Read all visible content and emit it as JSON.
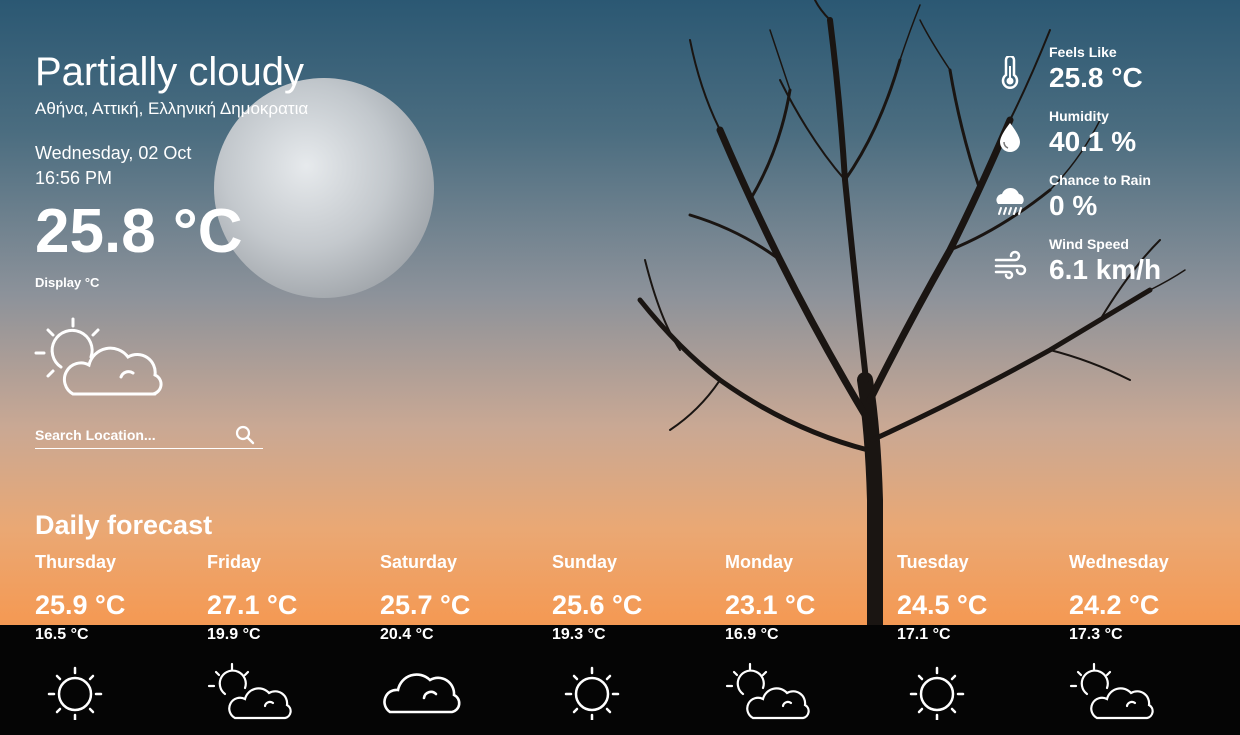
{
  "current": {
    "condition": "Partially cloudy",
    "location": "Αθήνα, Αττική, Ελληνική Δημοκρατια",
    "date": "Wednesday, 02 Oct",
    "time": "16:56 PM",
    "temperature": "25.8 °C",
    "unit_toggle": "Display °C",
    "icon": "partly-cloudy-icon"
  },
  "search": {
    "placeholder": "Search Location..."
  },
  "stats": [
    {
      "label": "Feels Like",
      "value": "25.8 °C",
      "icon": "thermometer-icon"
    },
    {
      "label": "Humidity",
      "value": "40.1 %",
      "icon": "droplet-icon"
    },
    {
      "label": "Chance to Rain",
      "value": "0 %",
      "icon": "rain-cloud-icon"
    },
    {
      "label": "Wind Speed",
      "value": "6.1 km/h",
      "icon": "wind-icon"
    }
  ],
  "forecast": {
    "title": "Daily forecast",
    "days": [
      {
        "day": "Thursday",
        "max": "25.9 °C",
        "min": "16.5 °C",
        "icon": "sun-icon"
      },
      {
        "day": "Friday",
        "max": "27.1 °C",
        "min": "19.9 °C",
        "icon": "partly-cloudy-icon"
      },
      {
        "day": "Saturday",
        "max": "25.7 °C",
        "min": "20.4 °C",
        "icon": "cloud-icon"
      },
      {
        "day": "Sunday",
        "max": "25.6 °C",
        "min": "19.3 °C",
        "icon": "sun-icon"
      },
      {
        "day": "Monday",
        "max": "23.1 °C",
        "min": "16.9 °C",
        "icon": "partly-cloudy-icon"
      },
      {
        "day": "Tuesday",
        "max": "24.5 °C",
        "min": "17.1 °C",
        "icon": "sun-icon"
      },
      {
        "day": "Wednesday",
        "max": "24.2 °C",
        "min": "17.3 °C",
        "icon": "partly-cloudy-icon"
      }
    ]
  }
}
